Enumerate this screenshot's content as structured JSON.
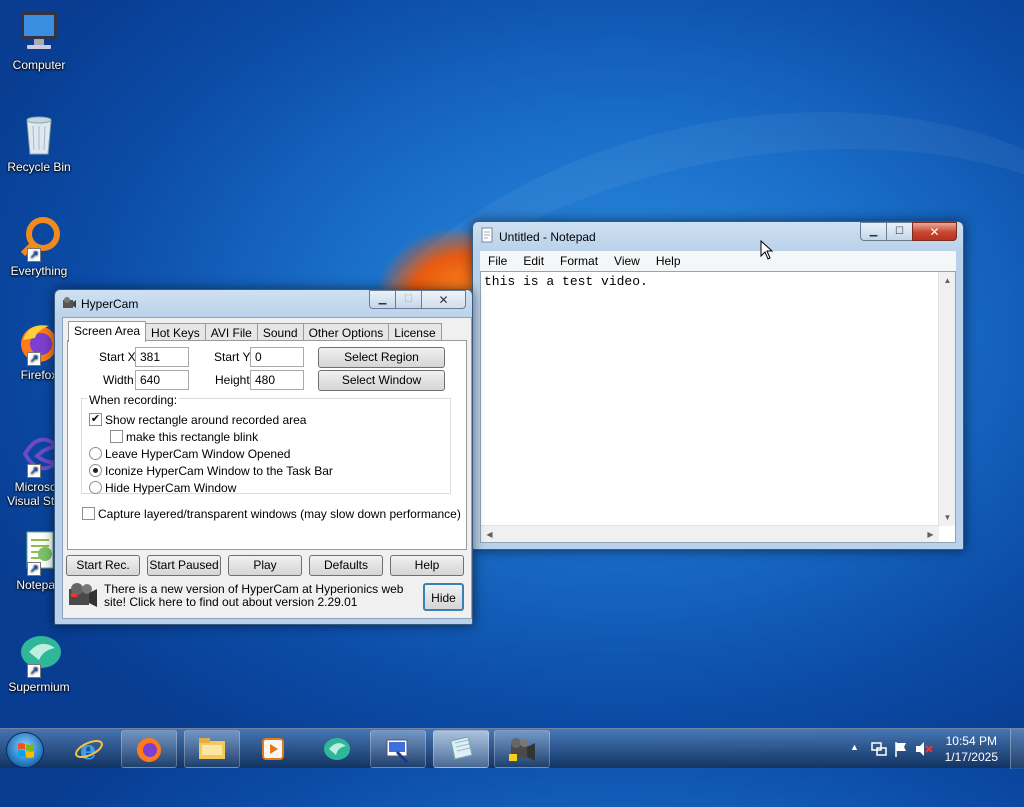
{
  "desktop": {
    "icons": [
      {
        "label": "Computer"
      },
      {
        "label": "Recycle Bin"
      },
      {
        "label": "Everything"
      },
      {
        "label": "Firefox"
      },
      {
        "label": "Microsoft Visual Stu..."
      },
      {
        "label": "Notepad"
      },
      {
        "label": "Supermium"
      }
    ]
  },
  "notepad": {
    "title": "Untitled - Notepad",
    "menu": [
      "File",
      "Edit",
      "Format",
      "View",
      "Help"
    ],
    "content": "this is a test video."
  },
  "hypercam": {
    "title": "HyperCam",
    "tabs": [
      "Screen Area",
      "Hot Keys",
      "AVI File",
      "Sound",
      "Other Options",
      "License"
    ],
    "start_x_label": "Start X",
    "start_x": "381",
    "start_y_label": "Start Y",
    "start_y": "0",
    "width_label": "Width",
    "width": "640",
    "height_label": "Height",
    "height": "480",
    "select_region": "Select Region",
    "select_window": "Select Window",
    "when_recording": "When recording:",
    "show_rect": "Show rectangle around recorded area",
    "show_rect_checked": true,
    "blink": "make this rectangle blink",
    "blink_checked": false,
    "leave_opened": "Leave HyperCam Window Opened",
    "iconize": "Iconize HyperCam Window to the Task Bar",
    "hide_window": "Hide HyperCam Window",
    "selected_mode": "iconize",
    "capture_layered": "Capture layered/transparent windows (may slow down performance)",
    "capture_layered_checked": false,
    "buttons": {
      "start_rec": "Start Rec.",
      "start_paused": "Start Paused",
      "play": "Play",
      "defaults": "Defaults",
      "help": "Help"
    },
    "update_notice": "There is a new version of HyperCam at Hyperionics web site! Click here to find out about version 2.29.01",
    "hide_button": "Hide"
  },
  "taskbar": {
    "pinned": [
      "internet-explorer-icon",
      "firefox-icon",
      "file-explorer-icon",
      "media-player-icon",
      "supermium-icon",
      "visual-studio-icon",
      "notepad-icon",
      "hypercam-icon"
    ],
    "active": "notepad-icon",
    "time": "10:54 PM",
    "date": "1/17/2025"
  }
}
